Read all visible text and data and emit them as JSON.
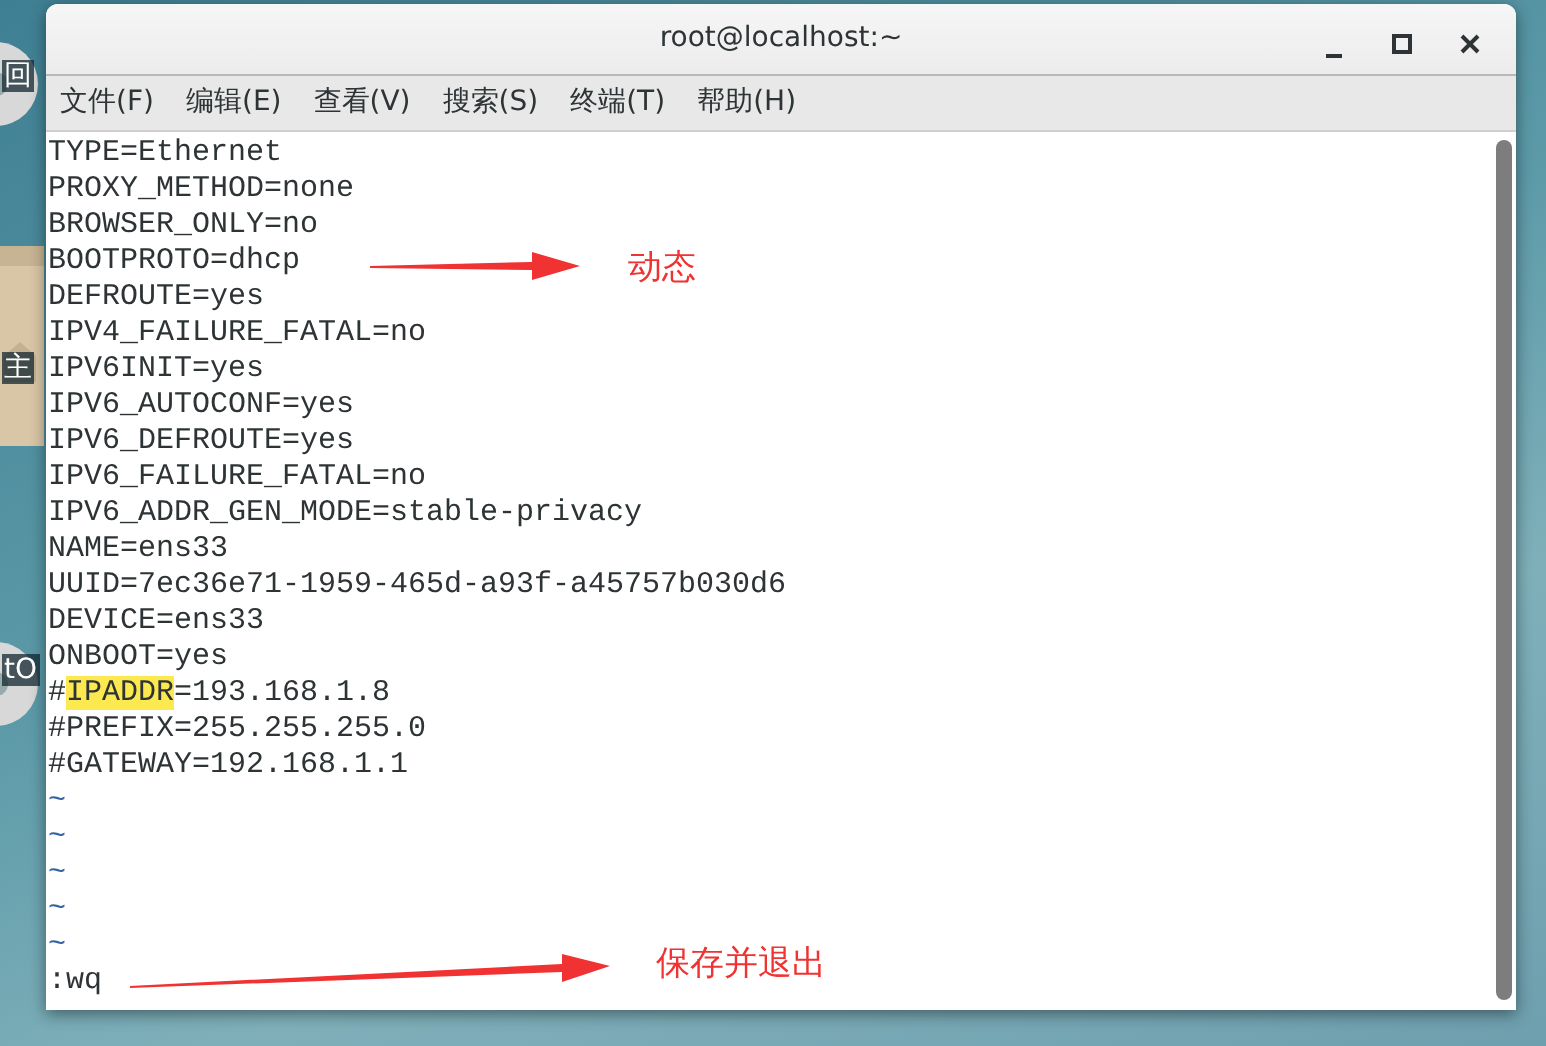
{
  "desktop_icons": [
    {
      "kind": "disc",
      "label": "回"
    },
    {
      "kind": "folder",
      "label": "主"
    },
    {
      "kind": "disc",
      "label": "tO"
    }
  ],
  "window": {
    "title": "root@localhost:~"
  },
  "menu": [
    "文件(F)",
    "编辑(E)",
    "查看(V)",
    "搜索(S)",
    "终端(T)",
    "帮助(H)"
  ],
  "lines": [
    {
      "kind": "text",
      "text": "TYPE=Ethernet"
    },
    {
      "kind": "text",
      "text": "PROXY_METHOD=none"
    },
    {
      "kind": "text",
      "text": "BROWSER_ONLY=no"
    },
    {
      "kind": "text",
      "text": "BOOTPROTO=dhcp"
    },
    {
      "kind": "text",
      "text": "DEFROUTE=yes"
    },
    {
      "kind": "text",
      "text": "IPV4_FAILURE_FATAL=no"
    },
    {
      "kind": "text",
      "text": "IPV6INIT=yes"
    },
    {
      "kind": "text",
      "text": "IPV6_AUTOCONF=yes"
    },
    {
      "kind": "text",
      "text": "IPV6_DEFROUTE=yes"
    },
    {
      "kind": "text",
      "text": "IPV6_FAILURE_FATAL=no"
    },
    {
      "kind": "text",
      "text": "IPV6_ADDR_GEN_MODE=stable-privacy"
    },
    {
      "kind": "text",
      "text": "NAME=ens33"
    },
    {
      "kind": "text",
      "text": "UUID=7ec36e71-1959-465d-a93f-a45757b030d6"
    },
    {
      "kind": "text",
      "text": "DEVICE=ens33"
    },
    {
      "kind": "text",
      "text": "ONBOOT=yes"
    },
    {
      "kind": "text",
      "segments": [
        {
          "text": "#",
          "highlighted": false
        },
        {
          "text": "IPADDR",
          "highlighted": true
        },
        {
          "text": "=193.168.1.8",
          "highlighted": false
        }
      ]
    },
    {
      "kind": "text",
      "text": "#PREFIX=255.255.255.0"
    },
    {
      "kind": "text",
      "text": "#GATEWAY=192.168.1.1"
    },
    {
      "kind": "tilde",
      "text": "~"
    },
    {
      "kind": "tilde",
      "text": "~"
    },
    {
      "kind": "tilde",
      "text": "~"
    },
    {
      "kind": "tilde",
      "text": "~"
    },
    {
      "kind": "tilde",
      "text": "~"
    },
    {
      "kind": "command",
      "text": ":wq"
    }
  ],
  "annotations": [
    {
      "label": "动态"
    },
    {
      "label": "保存并退出"
    }
  ]
}
